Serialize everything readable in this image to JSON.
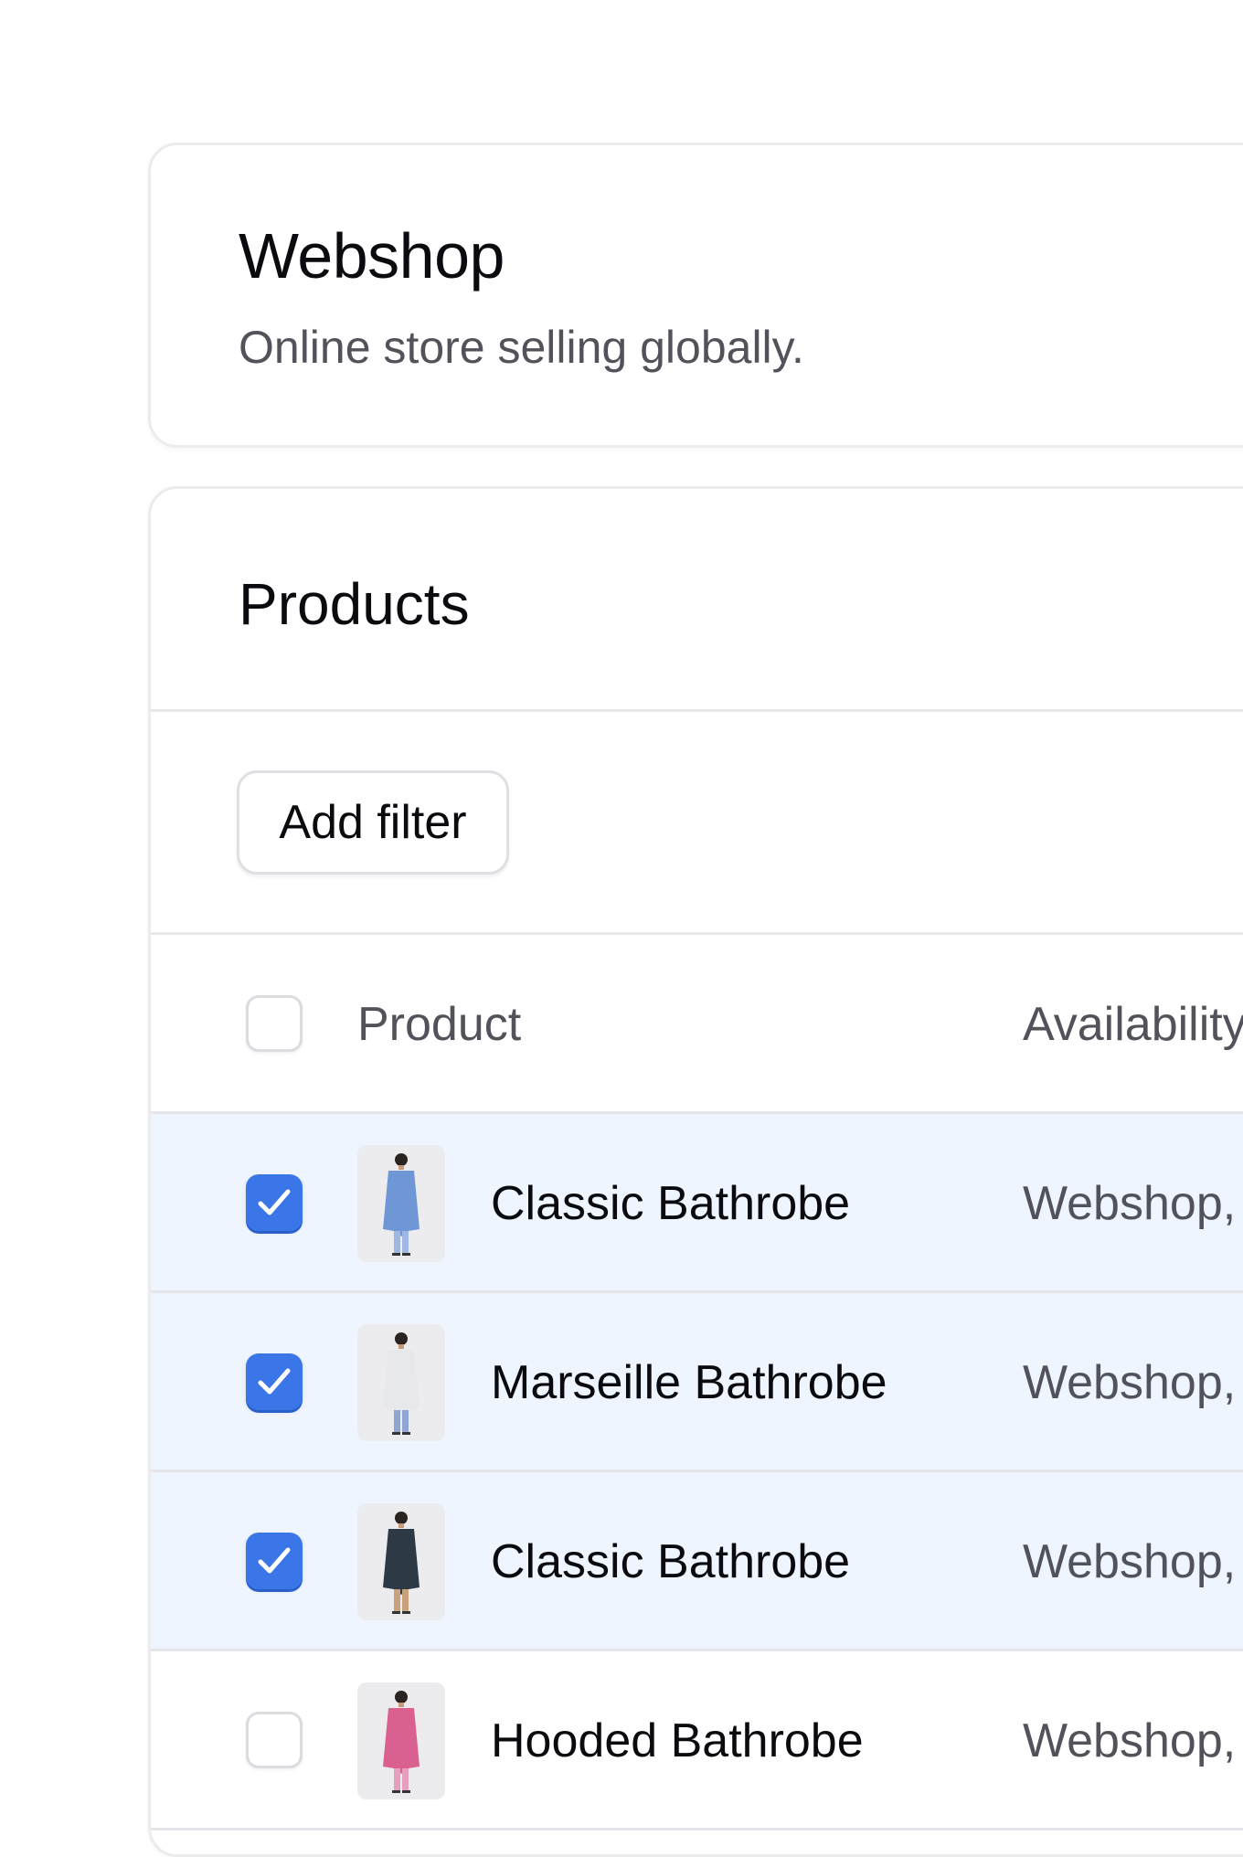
{
  "store": {
    "title": "Webshop",
    "description": "Online store selling globally."
  },
  "products_section": {
    "title": "Products",
    "add_filter_label": "Add filter",
    "columns": {
      "product": "Product",
      "availability": "Availability"
    },
    "rows": [
      {
        "name": "Classic Bathrobe",
        "availability": "Webshop,",
        "selected": true,
        "robe_color": "#6f97d6",
        "pants_color": "#9fb8e3"
      },
      {
        "name": "Marseille Bathrobe",
        "availability": "Webshop,",
        "selected": true,
        "robe_color": "#e6e8ea",
        "pants_color": "#8fa6d4"
      },
      {
        "name": "Classic Bathrobe",
        "availability": "Webshop,",
        "selected": true,
        "robe_color": "#2d3945",
        "pants_color": "#c9a27c"
      },
      {
        "name": "Hooded Bathrobe",
        "availability": "Webshop,",
        "selected": false,
        "robe_color": "#d9608f",
        "pants_color": "#e6a0bd"
      }
    ]
  },
  "colors": {
    "accent": "#3b76e8",
    "selected_row": "#eff5ff",
    "muted_text": "#52525b"
  }
}
